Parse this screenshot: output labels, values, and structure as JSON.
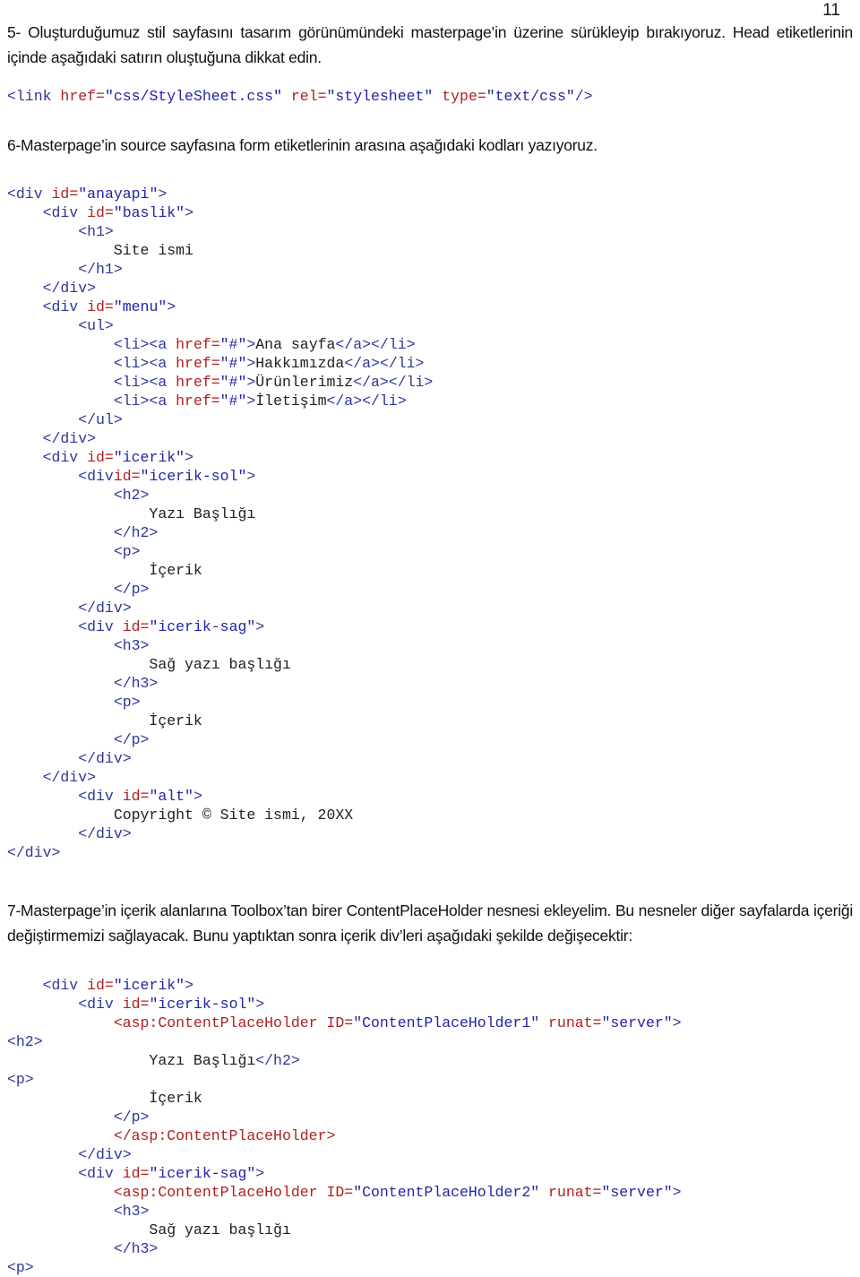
{
  "page": {
    "number": "11"
  },
  "paragraphs": {
    "step5": "5- Oluşturduğumuz stil sayfasını tasarım görünümündeki masterpage’in üzerine sürükleyip bırakıyoruz. Head etiketlerinin içinde aşağıdaki satırın oluştuğuna dikkat edin.",
    "step6": "6-Masterpage’in source sayfasına form etiketlerinin arasına aşağıdaki kodları yazıyoruz.",
    "step7": "7-Masterpage’in içerik alanlarına Toolbox’tan birer ContentPlaceHolder nesnesi ekleyelim. Bu nesneler diğer sayfalarda içeriği değiştirmemizi sağlayacak. Bunu yaptıktan sonra içerik div’leri aşağıdaki şekilde değişecektir:"
  },
  "code_link": {
    "lines": [
      [
        {
          "t": "text",
          "v": "<link ",
          "c": "t"
        },
        {
          "t": "text",
          "v": "href=",
          "c": "an"
        },
        {
          "t": "text",
          "v": "\"css/StyleSheet.css\"",
          "c": "av"
        },
        {
          "t": "text",
          "v": " ",
          "c": "t"
        },
        {
          "t": "text",
          "v": "rel=",
          "c": "an"
        },
        {
          "t": "text",
          "v": "\"stylesheet\"",
          "c": "av"
        },
        {
          "t": "text",
          "v": " ",
          "c": "t"
        },
        {
          "t": "text",
          "v": "type=",
          "c": "an"
        },
        {
          "t": "text",
          "v": "\"text/css\"",
          "c": "av"
        },
        {
          "t": "text",
          "v": "/>",
          "c": "t"
        }
      ]
    ]
  },
  "code_masterpage": {
    "lines": [
      [
        {
          "v": "<div ",
          "c": "t"
        },
        {
          "v": "id=",
          "c": "an"
        },
        {
          "v": "\"anayapi\"",
          "c": "av"
        },
        {
          "v": ">",
          "c": "t"
        }
      ],
      [
        {
          "v": "    <div ",
          "c": "t"
        },
        {
          "v": "id=",
          "c": "an"
        },
        {
          "v": "\"baslik\"",
          "c": "av"
        },
        {
          "v": ">",
          "c": "t"
        }
      ],
      [
        {
          "v": "        <h1>",
          "c": "t"
        }
      ],
      [
        {
          "v": "            Site ismi",
          "c": "tx"
        }
      ],
      [
        {
          "v": "        </h1>",
          "c": "t"
        }
      ],
      [
        {
          "v": "    </div>",
          "c": "t"
        }
      ],
      [
        {
          "v": "    <div ",
          "c": "t"
        },
        {
          "v": "id=",
          "c": "an"
        },
        {
          "v": "\"menu\"",
          "c": "av"
        },
        {
          "v": ">",
          "c": "t"
        }
      ],
      [
        {
          "v": "        <ul>",
          "c": "t"
        }
      ],
      [
        {
          "v": "            <li><a ",
          "c": "t"
        },
        {
          "v": "href=",
          "c": "an"
        },
        {
          "v": "\"#\"",
          "c": "av"
        },
        {
          "v": ">",
          "c": "t"
        },
        {
          "v": "Ana sayfa",
          "c": "tx"
        },
        {
          "v": "</a></li>",
          "c": "t"
        }
      ],
      [
        {
          "v": "            <li><a ",
          "c": "t"
        },
        {
          "v": "href=",
          "c": "an"
        },
        {
          "v": "\"#\"",
          "c": "av"
        },
        {
          "v": ">",
          "c": "t"
        },
        {
          "v": "Hakkımızda",
          "c": "tx"
        },
        {
          "v": "</a></li>",
          "c": "t"
        }
      ],
      [
        {
          "v": "            <li><a ",
          "c": "t"
        },
        {
          "v": "href=",
          "c": "an"
        },
        {
          "v": "\"#\"",
          "c": "av"
        },
        {
          "v": ">",
          "c": "t"
        },
        {
          "v": "Ürünlerimiz",
          "c": "tx"
        },
        {
          "v": "</a></li>",
          "c": "t"
        }
      ],
      [
        {
          "v": "            <li><a ",
          "c": "t"
        },
        {
          "v": "href=",
          "c": "an"
        },
        {
          "v": "\"#\"",
          "c": "av"
        },
        {
          "v": ">",
          "c": "t"
        },
        {
          "v": "İletişim",
          "c": "tx"
        },
        {
          "v": "</a></li>",
          "c": "t"
        }
      ],
      [
        {
          "v": "        </ul>",
          "c": "t"
        }
      ],
      [
        {
          "v": "    </div>",
          "c": "t"
        }
      ],
      [
        {
          "v": "    <div ",
          "c": "t"
        },
        {
          "v": "id=",
          "c": "an"
        },
        {
          "v": "\"icerik\"",
          "c": "av"
        },
        {
          "v": ">",
          "c": "t"
        }
      ],
      [
        {
          "v": "        <div",
          "c": "t"
        },
        {
          "v": "id=",
          "c": "an"
        },
        {
          "v": "\"icerik-sol\"",
          "c": "av"
        },
        {
          "v": ">",
          "c": "t"
        }
      ],
      [
        {
          "v": "            <h2>",
          "c": "t"
        }
      ],
      [
        {
          "v": "                Yazı Başlığı",
          "c": "tx"
        }
      ],
      [
        {
          "v": "            </h2>",
          "c": "t"
        }
      ],
      [
        {
          "v": "            <p>",
          "c": "t"
        }
      ],
      [
        {
          "v": "                İçerik",
          "c": "tx"
        }
      ],
      [
        {
          "v": "            </p>",
          "c": "t"
        }
      ],
      [
        {
          "v": "        </div>",
          "c": "t"
        }
      ],
      [
        {
          "v": "        <div ",
          "c": "t"
        },
        {
          "v": "id=",
          "c": "an"
        },
        {
          "v": "\"icerik-sag\"",
          "c": "av"
        },
        {
          "v": ">",
          "c": "t"
        }
      ],
      [
        {
          "v": "            <h3>",
          "c": "t"
        }
      ],
      [
        {
          "v": "                Sağ yazı başlığı",
          "c": "tx"
        }
      ],
      [
        {
          "v": "            </h3>",
          "c": "t"
        }
      ],
      [
        {
          "v": "            <p>",
          "c": "t"
        }
      ],
      [
        {
          "v": "                İçerik",
          "c": "tx"
        }
      ],
      [
        {
          "v": "            </p>",
          "c": "t"
        }
      ],
      [
        {
          "v": "        </div>",
          "c": "t"
        }
      ],
      [
        {
          "v": "    </div>",
          "c": "t"
        }
      ],
      [
        {
          "v": "        <div ",
          "c": "t"
        },
        {
          "v": "id=",
          "c": "an"
        },
        {
          "v": "\"alt\"",
          "c": "av"
        },
        {
          "v": ">",
          "c": "t"
        }
      ],
      [
        {
          "v": "            Copyright © Site ismi, 20XX",
          "c": "tx"
        }
      ],
      [
        {
          "v": "        </div>",
          "c": "t"
        }
      ],
      [
        {
          "v": "</div>",
          "c": "t"
        }
      ]
    ]
  },
  "code_contentplaceholder": {
    "lines": [
      [
        {
          "v": "    <div ",
          "c": "t"
        },
        {
          "v": "id=",
          "c": "an"
        },
        {
          "v": "\"icerik\"",
          "c": "av"
        },
        {
          "v": ">",
          "c": "t"
        }
      ],
      [
        {
          "v": "        <div ",
          "c": "t"
        },
        {
          "v": "id=",
          "c": "an"
        },
        {
          "v": "\"icerik-sol\"",
          "c": "av"
        },
        {
          "v": ">",
          "c": "t"
        }
      ],
      [
        {
          "v": "            <asp:ContentPlaceHolder ",
          "c": "ns"
        },
        {
          "v": "ID=",
          "c": "an"
        },
        {
          "v": "\"ContentPlaceHolder1\"",
          "c": "av"
        },
        {
          "v": " ",
          "c": "t"
        },
        {
          "v": "runat=",
          "c": "an"
        },
        {
          "v": "\"server\"",
          "c": "av"
        },
        {
          "v": ">",
          "c": "t"
        }
      ],
      [
        {
          "v": "<h2>",
          "c": "t"
        }
      ],
      [
        {
          "v": "                Yazı Başlığı",
          "c": "tx"
        },
        {
          "v": "</h2>",
          "c": "t"
        }
      ],
      [
        {
          "v": "<p>",
          "c": "t"
        }
      ],
      [
        {
          "v": "                İçerik",
          "c": "tx"
        }
      ],
      [
        {
          "v": "            </p>",
          "c": "t"
        }
      ],
      [
        {
          "v": "            </asp:ContentPlaceHolder>",
          "c": "ns"
        }
      ],
      [
        {
          "v": "        </div>",
          "c": "t"
        }
      ],
      [
        {
          "v": "        <div ",
          "c": "t"
        },
        {
          "v": "id=",
          "c": "an"
        },
        {
          "v": "\"icerik-sag\"",
          "c": "av"
        },
        {
          "v": ">",
          "c": "t"
        }
      ],
      [
        {
          "v": "            <asp:ContentPlaceHolder ",
          "c": "ns"
        },
        {
          "v": "ID=",
          "c": "an"
        },
        {
          "v": "\"ContentPlaceHolder2\"",
          "c": "av"
        },
        {
          "v": " ",
          "c": "t"
        },
        {
          "v": "runat=",
          "c": "an"
        },
        {
          "v": "\"server\"",
          "c": "av"
        },
        {
          "v": ">",
          "c": "t"
        }
      ],
      [
        {
          "v": "            <h3>",
          "c": "t"
        }
      ],
      [
        {
          "v": "                Sağ yazı başlığı",
          "c": "tx"
        }
      ],
      [
        {
          "v": "            </h3>",
          "c": "t"
        }
      ],
      [
        {
          "v": "<p>",
          "c": "t"
        }
      ]
    ]
  }
}
